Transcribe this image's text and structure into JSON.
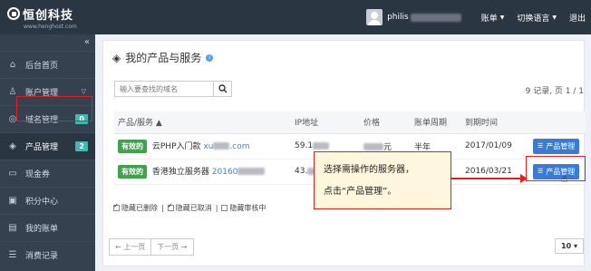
{
  "header": {
    "logo_text": "恒创科技",
    "logo_sub": "www.henghost.com",
    "username": "philis",
    "menu_account": "账单",
    "menu_language": "切换语言",
    "menu_logout": "退出"
  },
  "sidebar": {
    "collapse": "«",
    "items": [
      {
        "label": "后台首页",
        "icon": "home-icon"
      },
      {
        "label": "账户管理",
        "icon": "user-icon"
      },
      {
        "label": "域名管理",
        "icon": "globe-icon",
        "badge": "0"
      },
      {
        "label": "产品管理",
        "icon": "layers-icon",
        "badge": "2"
      },
      {
        "label": "现金券",
        "icon": "cash-icon"
      },
      {
        "label": "积分中心",
        "icon": "points-icon"
      },
      {
        "label": "我的账单",
        "icon": "bill-icon"
      },
      {
        "label": "消费记录",
        "icon": "record-icon"
      }
    ]
  },
  "main": {
    "title": "我的产品与服务",
    "search_placeholder": "输入要查找的域名",
    "record_info": "9 记录, 页 1 / 1",
    "columns": [
      "产品/服务",
      "IP地址",
      "价格",
      "账单周期",
      "到期时间"
    ],
    "rows": [
      {
        "status": "有效的",
        "name": "云PHP入门款",
        "domain": "xu",
        "domain_tail": ".com",
        "ip": "59.1",
        "price_tail": "元",
        "cycle": "半年",
        "expire": "2017/01/09",
        "action": "产品管理"
      },
      {
        "status": "有效的",
        "name": "香港独立服务器",
        "domain": "20160",
        "domain_tail": "",
        "ip": "43.",
        "price_tail": "",
        "cycle": "",
        "expire": "2016/03/21",
        "action": "产品管理"
      }
    ],
    "callout_line1": "选择需操作的服务器，",
    "callout_line2": "点击“产品管理”。",
    "filters": [
      "隐藏已删除",
      "隐藏已取消",
      "隐藏审核中"
    ],
    "filter_sep": "|",
    "prev": "← 上一页",
    "next": "下一页 →",
    "per_page": "10"
  }
}
